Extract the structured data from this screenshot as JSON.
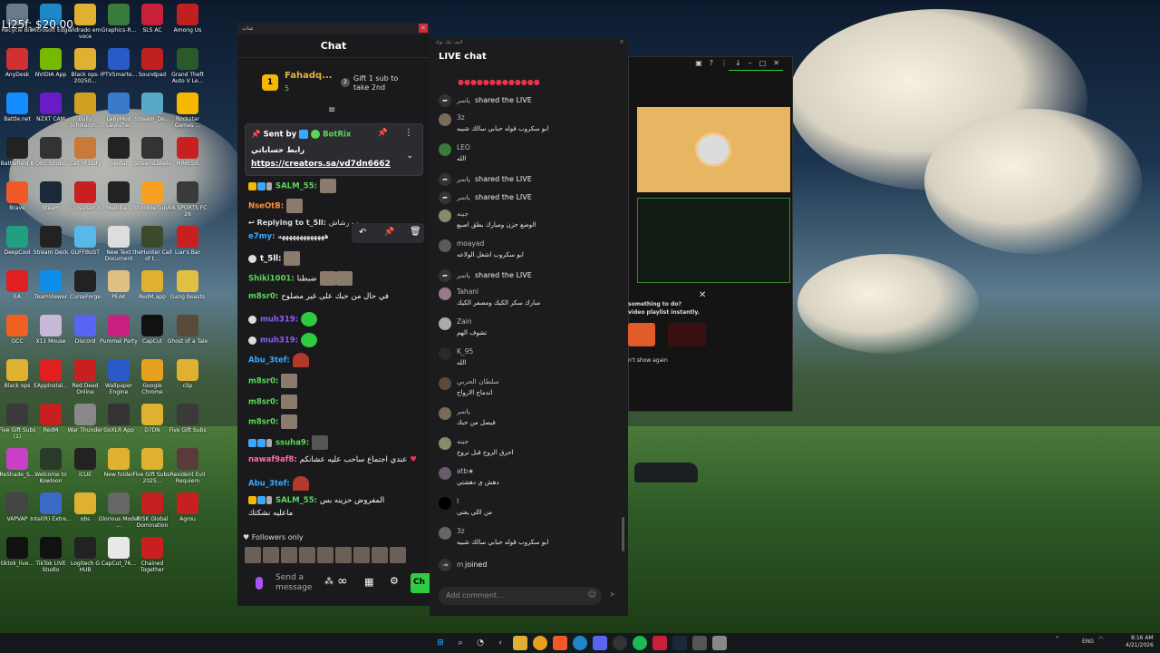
{
  "desktop": {
    "overlay_text": "Li25f: $20.00",
    "icons": [
      {
        "label": "Recycle Bin",
        "color": "#6b7b8c"
      },
      {
        "label": "Microsoft Edge",
        "color": "#1e88c8"
      },
      {
        "label": "Vidrado em voce",
        "color": "#e0b030"
      },
      {
        "label": "Graphics-R...",
        "color": "#3a7a3a"
      },
      {
        "label": "SLS AC",
        "color": "#c8203a"
      },
      {
        "label": "Among Us",
        "color": "#c02020"
      },
      {
        "label": "AnyDesk",
        "color": "#d03030"
      },
      {
        "label": "NVIDIA App",
        "color": "#76b900"
      },
      {
        "label": "Black ops-20250...",
        "color": "#e0b030"
      },
      {
        "label": "IPTVSmarte...",
        "color": "#2a5ac8"
      },
      {
        "label": "Soundpad",
        "color": "#c02020"
      },
      {
        "label": "Grand Theft Auto V Le...",
        "color": "#2a5a2a"
      },
      {
        "label": "Battle.net",
        "color": "#148eff"
      },
      {
        "label": "NZXT CAM",
        "color": "#6a1bc8"
      },
      {
        "label": "Bully Scholarsh...",
        "color": "#d0a020"
      },
      {
        "label": "LabyMod Launcher",
        "color": "#3a7ac8"
      },
      {
        "label": "Stream_De...",
        "color": "#58a8c8"
      },
      {
        "label": "Rockstar Games ...",
        "color": "#f5b700"
      },
      {
        "label": "Battlefield 6",
        "color": "#222"
      },
      {
        "label": "OBS Studio",
        "color": "#333"
      },
      {
        "label": "Call of Duty",
        "color": "#c87a3a"
      },
      {
        "label": "Medal",
        "color": "#222"
      },
      {
        "label": "StreamLabels",
        "color": "#333"
      },
      {
        "label": "MIMESIS",
        "color": "#c82020"
      },
      {
        "label": "Brave",
        "color": "#f05a28"
      },
      {
        "label": "Steam",
        "color": "#1b2838"
      },
      {
        "label": "Crosshair X",
        "color": "#c82020"
      },
      {
        "label": "MediBa...",
        "color": "#222"
      },
      {
        "label": "Stumble Guys",
        "color": "#f5a020"
      },
      {
        "label": "EA SPORTS FC 26",
        "color": "#3a3a3a"
      },
      {
        "label": "DeepCool",
        "color": "#20a080"
      },
      {
        "label": "Stream Deck",
        "color": "#222"
      },
      {
        "label": "GUFFBUST",
        "color": "#58b8e8"
      },
      {
        "label": "New Text Document",
        "color": "#ddd"
      },
      {
        "label": "theHunter Call of t...",
        "color": "#3a4a2a"
      },
      {
        "label": "Liar's Bar",
        "color": "#c82020"
      },
      {
        "label": "EA",
        "color": "#e02020"
      },
      {
        "label": "TeamViewer",
        "color": "#0e8ee9"
      },
      {
        "label": "CurseForge",
        "color": "#222"
      },
      {
        "label": "PEAK",
        "color": "#e0c080"
      },
      {
        "label": "RedM.app",
        "color": "#e0b030"
      },
      {
        "label": "Gang Beasts",
        "color": "#e0c040"
      },
      {
        "label": "GCC",
        "color": "#f06020"
      },
      {
        "label": "X11 Mouse",
        "color": "#c8b8d8"
      },
      {
        "label": "Discord",
        "color": "#5865f2"
      },
      {
        "label": "Pummel Party",
        "color": "#c82080"
      },
      {
        "label": "CapCut",
        "color": "#111"
      },
      {
        "label": "Ghost of a Tale",
        "color": "#5a4a3a"
      },
      {
        "label": "Black ops",
        "color": "#e0b030"
      },
      {
        "label": "EAppinstal...",
        "color": "#e02020"
      },
      {
        "label": "Red Dead Online",
        "color": "#c82020"
      },
      {
        "label": "Wallpaper Engine",
        "color": "#2a5ac8"
      },
      {
        "label": "Google Chrome",
        "color": "#e8a020"
      },
      {
        "label": "clip",
        "color": "#e0b030"
      },
      {
        "label": "Five Gift Subs (1)",
        "color": "#3a3a3a"
      },
      {
        "label": "RedM",
        "color": "#c82020"
      },
      {
        "label": "War Thunder",
        "color": "#888"
      },
      {
        "label": "GoXLR App",
        "color": "#333"
      },
      {
        "label": "D7DN",
        "color": "#e0b030"
      },
      {
        "label": "Five Gift Subs",
        "color": "#3a3a3a"
      },
      {
        "label": "ReShade_S...",
        "color": "#c840c8"
      },
      {
        "label": "Welcome to Kowloon",
        "color": "#2a3a2a"
      },
      {
        "label": "iCUE",
        "color": "#222"
      },
      {
        "label": "New folder",
        "color": "#e0b030"
      },
      {
        "label": "Five Gift Subs-2025...",
        "color": "#e0b030"
      },
      {
        "label": "Resident Evil Requiem",
        "color": "#5a3a3a"
      },
      {
        "label": "VAPVAP",
        "color": "#444"
      },
      {
        "label": "Intel(R) Extre...",
        "color": "#3a6ac8"
      },
      {
        "label": "obs",
        "color": "#e0b030"
      },
      {
        "label": "Glorious Model ...",
        "color": "#666"
      },
      {
        "label": "RISK Global Domination",
        "color": "#c82020"
      },
      {
        "label": "Agrou",
        "color": "#c82020"
      },
      {
        "label": "tiktok_live...",
        "color": "#111"
      },
      {
        "label": "TikTok LIVE Studio",
        "color": "#111"
      },
      {
        "label": "Logitech G HUB",
        "color": "#222"
      },
      {
        "label": "CapCut_76...",
        "color": "#e8e8e8"
      },
      {
        "label": "Chained Together",
        "color": "#c82020"
      }
    ]
  },
  "chat_window": {
    "titlebar": "شات",
    "header": "Chat",
    "top_gifter": {
      "rank": "1",
      "name": "Fahadq...",
      "count": "5"
    },
    "gift_prompt": {
      "count": "2",
      "text": "Gift 1 sub to take 2nd"
    },
    "pinned": {
      "sent_by_label": "Sent by",
      "sender": "BotRix",
      "title": "رابط حساباتي",
      "link": "https://creators.sa/vd7dn6662"
    },
    "replying_label": "Replying to",
    "replying_user": "t_5ll:",
    "replying_snippet": "ب رشاش",
    "messages": [
      {
        "user": "SALM_55:",
        "text": "",
        "color": "#5bd75b"
      },
      {
        "user": "NseOtB:",
        "text": "",
        "color": "#ff8c3a"
      },
      {
        "user": "e7my:",
        "text": "هههههههههههههه",
        "color": "#3aa8ff"
      },
      {
        "user": "t_5ll:",
        "text": "",
        "color": "#ffffff"
      },
      {
        "user": "Shiki1001:",
        "text": "ضبطنا",
        "color": "#5bd75b"
      },
      {
        "user": "m8sr0:",
        "text": "في حال من حبك على غير مصلوح",
        "color": "#5bd75b"
      },
      {
        "user": "muh319:",
        "text": "",
        "color": "#8a5bff"
      },
      {
        "user": "muh319:",
        "text": "",
        "color": "#8a5bff"
      },
      {
        "user": "Abu_3tef:",
        "text": "",
        "color": "#3aa8ff"
      },
      {
        "user": "m8sr0:",
        "text": "",
        "color": "#5bd75b"
      },
      {
        "user": "m8sr0:",
        "text": "",
        "color": "#5bd75b"
      },
      {
        "user": "m8sr0:",
        "text": "",
        "color": "#5bd75b"
      },
      {
        "user": "ssuha9:",
        "text": "",
        "color": "#5bd75b"
      },
      {
        "user": "nawaf9af8:",
        "text": "عندي اجتماع ساحب عليه عشانكم",
        "color": "#ff6ea8"
      },
      {
        "user": "Abu_3tef:",
        "text": "",
        "color": "#3aa8ff"
      },
      {
        "user": "SALM_55:",
        "text": "المفروض حزينه بس",
        "color": "#5bd75b"
      }
    ],
    "last_line": "ماعليه نشكتك",
    "followers_only": "Followers only",
    "composer_placeholder": "Send a message",
    "chat_button": "Ch"
  },
  "live_chat": {
    "small_title": "لايف تيك توك",
    "title": "LIVE chat",
    "hearts": "●●●●●●●●●●●●●",
    "comments": [
      {
        "name": "ياسر",
        "text": "shared the LIVE",
        "type": "share"
      },
      {
        "name": "3z",
        "text": "ابو سكروب قوله حبابي سالك شبيه",
        "type": "comment"
      },
      {
        "name": "LEO",
        "text": "الله",
        "type": "comment"
      },
      {
        "name": "ياسر",
        "text": "shared the LIVE",
        "type": "share"
      },
      {
        "name": "ياسر",
        "text": "shared the LIVE",
        "type": "share"
      },
      {
        "name": "جينه",
        "text": "الوضع حزن ومبارك بطق اصبع",
        "type": "comment"
      },
      {
        "name": "moayad",
        "text": "ابو سكروب اشغل الولاعه",
        "type": "comment"
      },
      {
        "name": "ياسر",
        "text": "shared the LIVE",
        "type": "share"
      },
      {
        "name": "Tahani",
        "text": "مبارك سكر الكيك ومصفر الكيك",
        "type": "comment"
      },
      {
        "name": "Zain",
        "text": "تشوف الهم",
        "type": "comment"
      },
      {
        "name": "K_95",
        "text": "الله",
        "type": "comment"
      },
      {
        "name": "سلطان الحربي",
        "text": "اندماج الارواح",
        "type": "comment"
      },
      {
        "name": "ياسر",
        "text": "فيصل من حبك",
        "type": "comment"
      },
      {
        "name": "جينه",
        "text": "احرق الروح قبل تروح",
        "type": "comment"
      },
      {
        "name": "atb★",
        "text": "دهش ي دهشتي",
        "type": "comment"
      },
      {
        "name": "I",
        "text": "من اللي يغني",
        "type": "comment"
      },
      {
        "name": "3z",
        "text": "ابو سكروب قوله حبابي سالك شبيه",
        "type": "comment"
      },
      {
        "name": "m",
        "text": "joined",
        "type": "join"
      }
    ],
    "comment_placeholder": "Add comment..."
  },
  "video_window": {
    "popup_title": "something to do?",
    "popup_sub": "video playlist instantly.",
    "popup_dismiss": "n't show again"
  },
  "taskbar": {
    "lang": "ENG",
    "time": "8:16 AM",
    "date": "4/21/2026"
  }
}
